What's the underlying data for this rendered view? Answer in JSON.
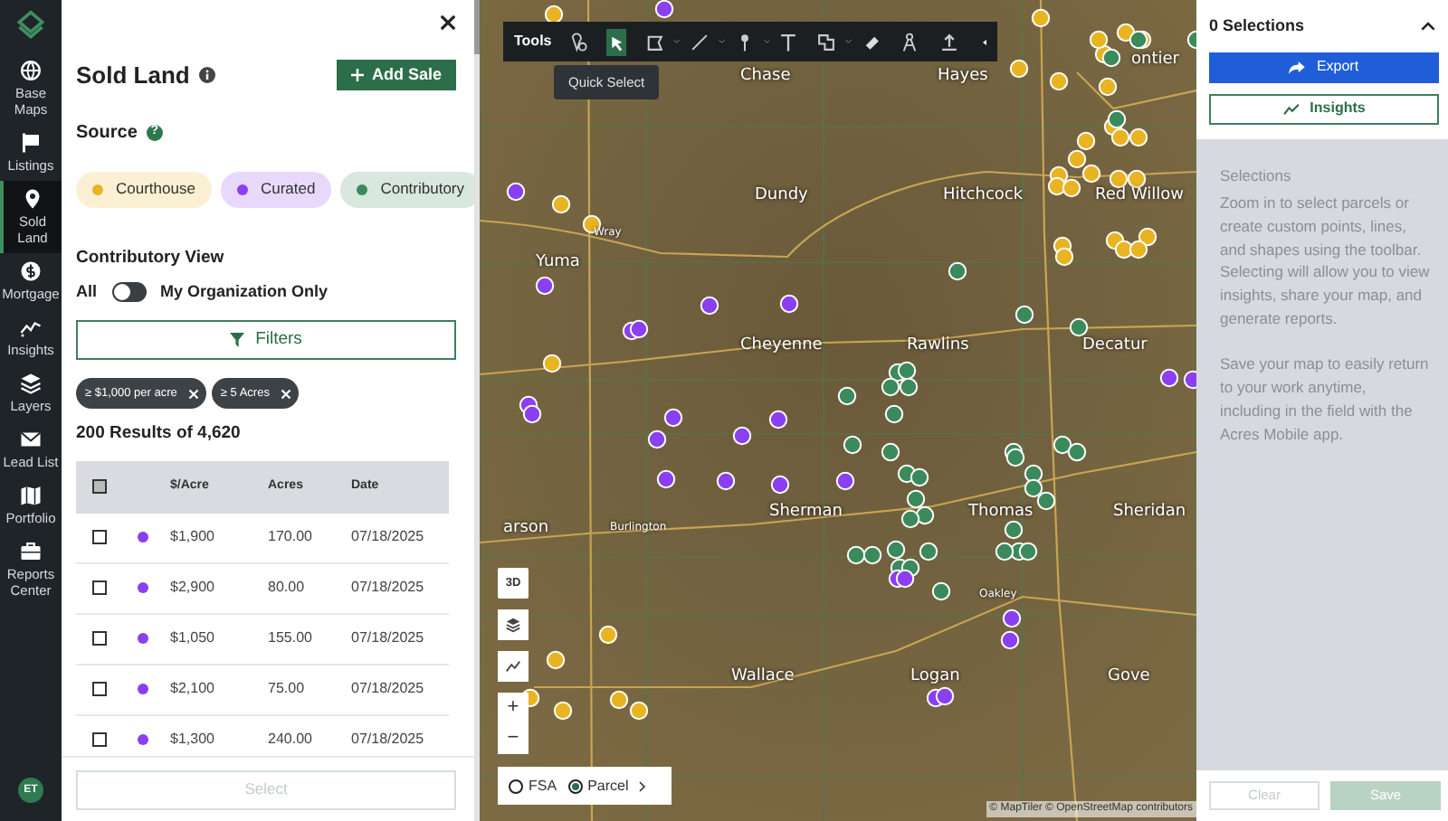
{
  "nav": {
    "items": [
      {
        "label": "Base Maps",
        "selected": false
      },
      {
        "label": "Listings",
        "selected": false
      },
      {
        "label": "Sold Land",
        "selected": true
      },
      {
        "label": "Mortgage",
        "selected": false
      },
      {
        "label": "Insights",
        "selected": false
      },
      {
        "label": "Layers",
        "selected": false
      },
      {
        "label": "Lead List",
        "selected": false
      },
      {
        "label": "Portfolio",
        "selected": false
      },
      {
        "label": "Reports Center",
        "selected": false
      }
    ],
    "avatar": "ET"
  },
  "panel": {
    "title": "Sold Land",
    "add_button": "Add Sale",
    "source_label": "Source",
    "source_help": "?",
    "sources": [
      {
        "label": "Courthouse",
        "color": "#e9b421"
      },
      {
        "label": "Curated",
        "color": "#8a3ff0"
      },
      {
        "label": "Contributory",
        "color": "#3a8a5c"
      }
    ],
    "contributory": {
      "title": "Contributory View",
      "left_label": "All",
      "right_label": "My Organization Only",
      "on": false
    },
    "filters_button": "Filters",
    "filter_tags": [
      "≥ $1,000 per acre",
      "≥ 5 Acres"
    ],
    "results": "200 Results of 4,620",
    "table": {
      "header_checked": false,
      "columns": [
        "$/Acre",
        "Acres",
        "Date"
      ],
      "rows": [
        {
          "checked": false,
          "color": "#8a3ff0",
          "cells": [
            "$1,900",
            "170.00",
            "07/18/2025"
          ]
        },
        {
          "checked": false,
          "color": "#8a3ff0",
          "cells": [
            "$2,900",
            "80.00",
            "07/18/2025"
          ]
        },
        {
          "checked": false,
          "color": "#8a3ff0",
          "cells": [
            "$1,050",
            "155.00",
            "07/18/2025"
          ]
        },
        {
          "checked": false,
          "color": "#8a3ff0",
          "cells": [
            "$2,100",
            "75.00",
            "07/18/2025"
          ]
        },
        {
          "checked": false,
          "color": "#8a3ff0",
          "cells": [
            "$1,300",
            "240.00",
            "07/18/2025"
          ]
        }
      ]
    },
    "select_button": {
      "label": "Select",
      "disabled": true
    }
  },
  "map": {
    "toolbar_label": "Tools",
    "tools": [
      {
        "selected": false
      },
      {
        "selected": true
      },
      {
        "selected": false
      },
      {
        "selected": false
      },
      {
        "selected": false
      },
      {
        "selected": false
      },
      {
        "selected": false
      },
      {
        "selected": false
      },
      {
        "selected": false
      },
      {
        "selected": false
      }
    ],
    "tooltip": "Quick Select",
    "place_labels": [
      "Chase",
      "Hayes",
      "ontier",
      "Dundy",
      "Hitchcock",
      "Red Willow",
      "Wray",
      "Yuma",
      "Cheyenne",
      "Rawlins",
      "Decatur",
      "Sherman",
      "Thomas",
      "Sheridan",
      "arson",
      "Burlington",
      "Oakley",
      "Wallace",
      "Logan",
      "Gove"
    ],
    "view_button": "3D",
    "zoom_in": "+",
    "zoom_out": "−",
    "layer_options": [
      {
        "label": "FSA",
        "selected": false
      },
      {
        "label": "Parcel",
        "selected": true
      }
    ],
    "attribution": "© MapTiler © OpenStreetMap contributors"
  },
  "selections": {
    "title": "0 Selections",
    "export_button": "Export",
    "insights_button": "Insights",
    "heading": "Selections",
    "paragraphs": [
      "Zoom in to select parcels or create custom points, lines, and shapes using the toolbar. Selecting will allow you to view insights, share your map, and generate reports.",
      "Save your map to easily return to your work anytime, including in the field with the Acres Mobile app."
    ],
    "clear_button": {
      "label": "Clear",
      "disabled": true
    },
    "save_button": {
      "label": "Save",
      "disabled": true
    }
  }
}
